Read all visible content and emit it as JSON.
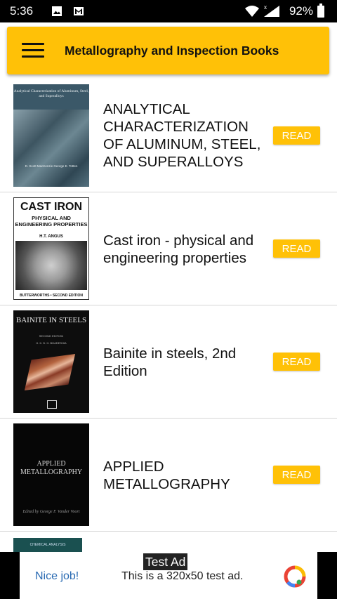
{
  "status_bar": {
    "time": "5:36",
    "battery": "92%",
    "icons": [
      "image-icon",
      "gmail-icon",
      "wifi-icon",
      "signal-icon",
      "battery-icon"
    ]
  },
  "app_bar": {
    "title": "Metallography and Inspection Books",
    "menu_icon": "menu-icon"
  },
  "books": [
    {
      "title": "ANALYTICAL CHARACTERIZATION OF ALUMINUM, STEEL, AND SUPERALLOYS",
      "button": "READ",
      "cover": {
        "title": "Analytical Characterization of Aluminum, Steel, and Superalloys",
        "authors": "D. Scott MacKenzie  George E. Totten"
      }
    },
    {
      "title": "Cast iron - physical and engineering properties",
      "button": "READ",
      "cover": {
        "title": "CAST IRON",
        "subtitle": "PHYSICAL AND ENGINEERING PROPERTIES",
        "author": "H.T. ANGUS",
        "footer": "BUTTERWORTHS • SECOND EDITION"
      }
    },
    {
      "title": "Bainite in steels, 2nd Edition",
      "button": "READ",
      "cover": {
        "title": "BAINITE IN STEELS",
        "edition": "SECOND EDITION",
        "author": "H. K. D. H. BHADESHIA"
      }
    },
    {
      "title": "APPLIED METALLOGRAPHY",
      "button": "READ",
      "cover": {
        "title": "APPLIED METALLOGRAPHY",
        "editor": "Edited by George F. Vander Voort"
      }
    }
  ],
  "partial_book": {
    "cover_text": "CHEMICAL ANALYSIS"
  },
  "ad": {
    "label": "Test Ad",
    "nice": "Nice job!",
    "text": "This is a 320x50 test ad."
  },
  "colors": {
    "accent": "#FFC107",
    "status_bar": "#000000",
    "ad_link": "#2a6bb3"
  }
}
